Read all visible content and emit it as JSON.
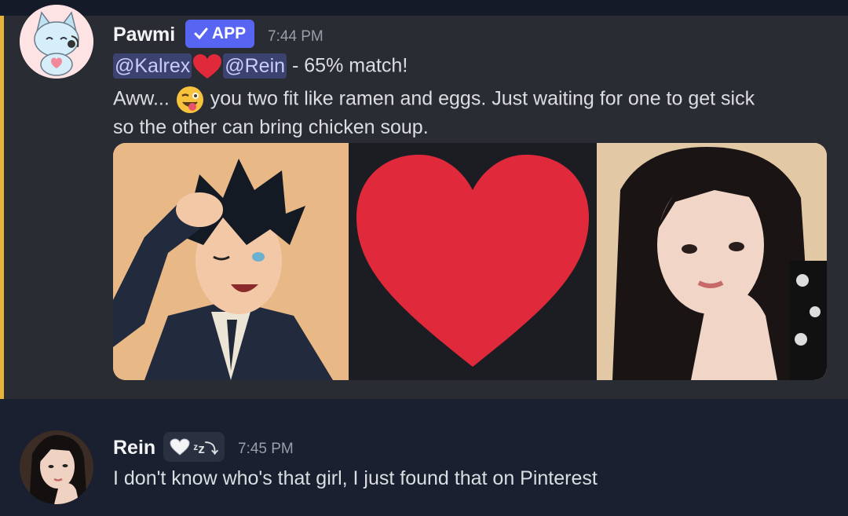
{
  "messages": [
    {
      "author": "Pawmi",
      "badge": "APP",
      "time": "7:44 PM",
      "mention1": "@Kalrex",
      "mention2": "@Rein",
      "match_text": " - 65% match!",
      "line2_a": "Aww...",
      "line2_b": " you two fit like ramen and eggs. Just waiting for one to get sick",
      "line3": "so the other can bring chicken soup."
    },
    {
      "author": "Rein",
      "status_text": "ᶻz⤵",
      "time": "7:45 PM",
      "text": "I don't know who's that girl, I just found that on Pinterest"
    }
  ],
  "colors": {
    "accent": "#e8b13a",
    "app_badge": "#5865f2",
    "heart": "#e02a3b"
  },
  "icons": [
    "cat-avatar-icon",
    "check-icon",
    "heart-icon",
    "wink-emoji-icon",
    "white-heart-icon"
  ]
}
